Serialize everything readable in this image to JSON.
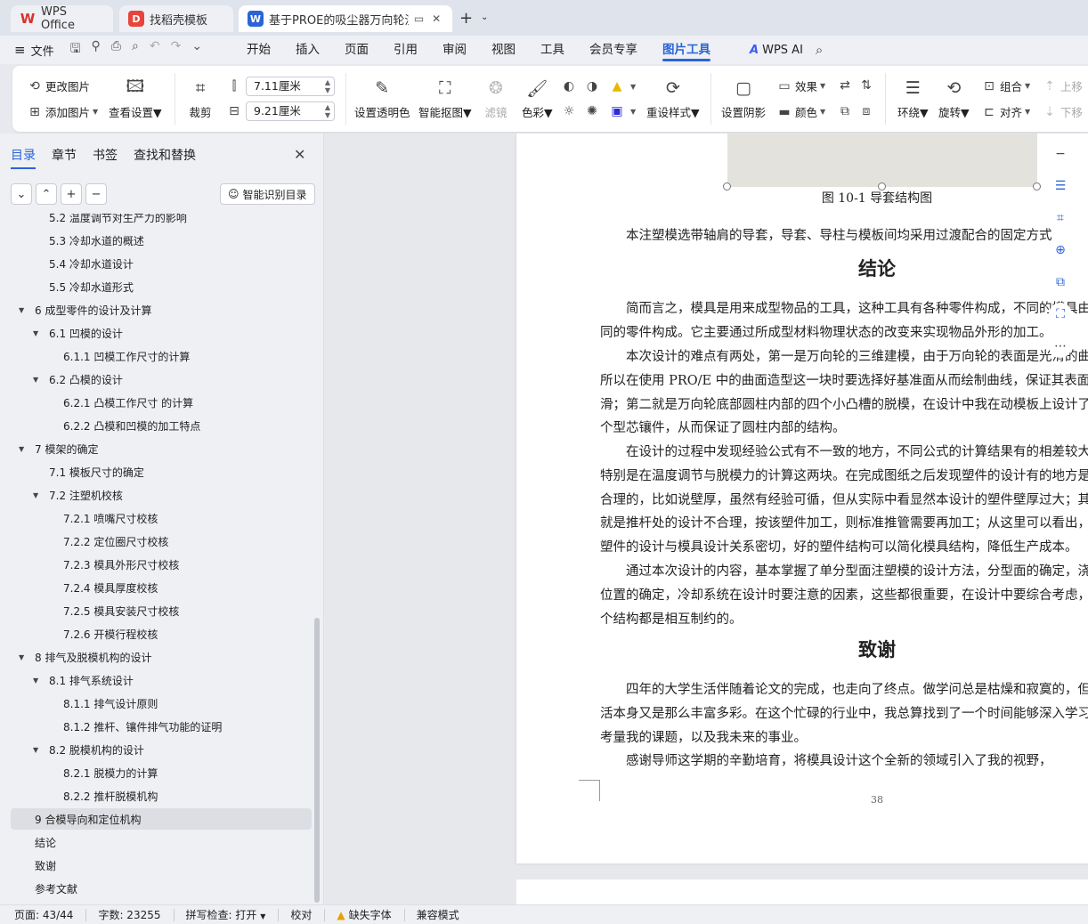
{
  "tabs": [
    {
      "label": "WPS Office",
      "icon": "wps-logo-icon"
    },
    {
      "label": "找稻壳模板",
      "icon": "docer-logo-icon"
    },
    {
      "label": "基于PROE的吸尘器万向轮注塑",
      "icon": "writer-logo-icon"
    }
  ],
  "menubar": {
    "file": "文件",
    "items": [
      "开始",
      "插入",
      "页面",
      "引用",
      "审阅",
      "视图",
      "工具",
      "会员专享",
      "图片工具"
    ],
    "active": "图片工具",
    "wps_ai": "WPS AI"
  },
  "ribbon": {
    "change_image": "更改图片",
    "add_image": "添加图片",
    "view_settings": "查看设置",
    "crop": "裁剪",
    "width_value": "7.11厘米",
    "height_value": "9.21厘米",
    "set_transparent": "设置透明色",
    "smart_cutout": "智能抠图",
    "filter": "滤镜",
    "color": "色彩",
    "reset_style": "重设样式",
    "set_shadow": "设置阴影",
    "effect": "效果",
    "fill_color": "颜色",
    "wrap": "环绕",
    "rotate": "旋转",
    "group": "组合",
    "align": "对齐",
    "move_up": "上移",
    "move_down": "下移"
  },
  "leftpanel": {
    "tabs": [
      "目录",
      "章节",
      "书签",
      "查找和替换"
    ],
    "active_tab": "目录",
    "smart_toc": "智能识别目录",
    "toc": [
      {
        "text": "5.2  温度调节对生产力的影响",
        "level": 2
      },
      {
        "text": "5.3  冷却水道的概述",
        "level": 2
      },
      {
        "text": "5.4  冷却水道设计",
        "level": 2
      },
      {
        "text": "5.5  冷却水道形式",
        "level": 2
      },
      {
        "text": "6  成型零件的设计及计算",
        "level": 1,
        "expanded": true
      },
      {
        "text": "6.1  凹模的设计",
        "level": 2,
        "expanded": true
      },
      {
        "text": "6.1.1  凹模工作尺寸的计算",
        "level": 3
      },
      {
        "text": "6.2  凸模的设计",
        "level": 2,
        "expanded": true
      },
      {
        "text": "6.2.1  凸模工作尺寸 的计算",
        "level": 3
      },
      {
        "text": "6.2.2  凸模和凹模的加工特点",
        "level": 3
      },
      {
        "text": "7  模架的确定",
        "level": 1,
        "expanded": true
      },
      {
        "text": "7.1  模板尺寸的确定",
        "level": 2
      },
      {
        "text": "7.2  注塑机校核",
        "level": 2,
        "expanded": true
      },
      {
        "text": "7.2.1  喷嘴尺寸校核",
        "level": 3
      },
      {
        "text": "7.2.2  定位圈尺寸校核",
        "level": 3
      },
      {
        "text": "7.2.3  模具外形尺寸校核",
        "level": 3
      },
      {
        "text": "7.2.4  模具厚度校核",
        "level": 3
      },
      {
        "text": "7.2.5  模具安装尺寸校核",
        "level": 3
      },
      {
        "text": "7.2.6  开模行程校核",
        "level": 3
      },
      {
        "text": "8  排气及脱模机构的设计",
        "level": 1,
        "expanded": true
      },
      {
        "text": "8.1  排气系统设计",
        "level": 2,
        "expanded": true
      },
      {
        "text": "8.1.1  排气设计原则",
        "level": 3
      },
      {
        "text": "8.1.2  推杆、镶件排气功能的证明",
        "level": 3
      },
      {
        "text": "8.2  脱模机构的设计",
        "level": 2,
        "expanded": true
      },
      {
        "text": "8.2.1  脱模力的计算",
        "level": 3
      },
      {
        "text": "8.2.2  推杆脱模机构",
        "level": 3
      },
      {
        "text": "9  合模导向和定位机构",
        "level": 1,
        "selected": true
      },
      {
        "text": "结论",
        "level": 1
      },
      {
        "text": "致谢",
        "level": 1
      },
      {
        "text": "参考文献",
        "level": 1
      }
    ]
  },
  "document": {
    "figure_caption": "图 10-1  导套结构图",
    "p_guide": "本注塑模选带轴肩的导套，导套、导柱与模板间均采用过渡配合的固定方式",
    "h_conclusion": "结论",
    "p1": [
      "简而言之，模具是用来成型物品的工具，这种工具有各种零件构成，不同的模具由不",
      "同的零件构成。它主要通过所成型材料物理状态的改变来实现物品外形的加工。"
    ],
    "p2": [
      "本次设计的难点有两处，第一是万向轮的三维建模，由于万向轮的表面是光滑的曲面，",
      "所以在使用 PRO/E 中的曲面造型这一块时要选择好基准面从而绘制曲线，保证其表面光",
      "滑；第二就是万向轮底部圆柱内部的四个小凸槽的脱模，在设计中我在动模板上设计了一",
      "个型芯镶件，从而保证了圆柱内部的结构。"
    ],
    "p3": [
      "在设计的过程中发现经验公式有不一致的地方，不同公式的计算结果有的相差较大，",
      "特别是在温度调节与脱模力的计算这两块。在完成图纸之后发现塑件的设计有的地方是不",
      "合理的，比如说壁厚，虽然有经验可循，但从实际中看显然本设计的塑件壁厚过大；其次",
      "就是推杆处的设计不合理，按该塑件加工，则标准推管需要再加工；从这里可以看出，",
      "塑件的设计与模具设计关系密切，好的塑件结构可以简化模具结构，降低生产成本。"
    ],
    "p4": [
      "通过本次设计的内容，基本掌握了单分型面注塑模的设计方法，分型面的确定，浇口",
      "位置的确定，冷却系统在设计时要注意的因素，这些都很重要，在设计中要综合考虑，各",
      "个结构都是相互制约的。"
    ],
    "h_thanks": "致谢",
    "p5": [
      "四年的大学生活伴随着论文的完成，也走向了终点。做学问总是枯燥和寂寞的，但生",
      "活本身又是那么丰富多彩。在这个忙碌的行业中，我总算找到了一个时间能够深入学习和思",
      "考量我的课题，以及我未来的事业。"
    ],
    "p6": [
      "感谢导师这学期的辛勤培育，将模具设计这个全新的领域引入了我的视野，"
    ],
    "page_number": "38"
  },
  "statusbar": {
    "page": "页面: 43/44",
    "words": "字数: 23255",
    "spell": "拼写检查: 打开",
    "proof": "校对",
    "missing_font": "缺失字体",
    "compat": "兼容模式"
  },
  "colors": {
    "accent": "#2b64d8",
    "titlebar": "#dfe3ec",
    "panel": "#eef0f4"
  }
}
